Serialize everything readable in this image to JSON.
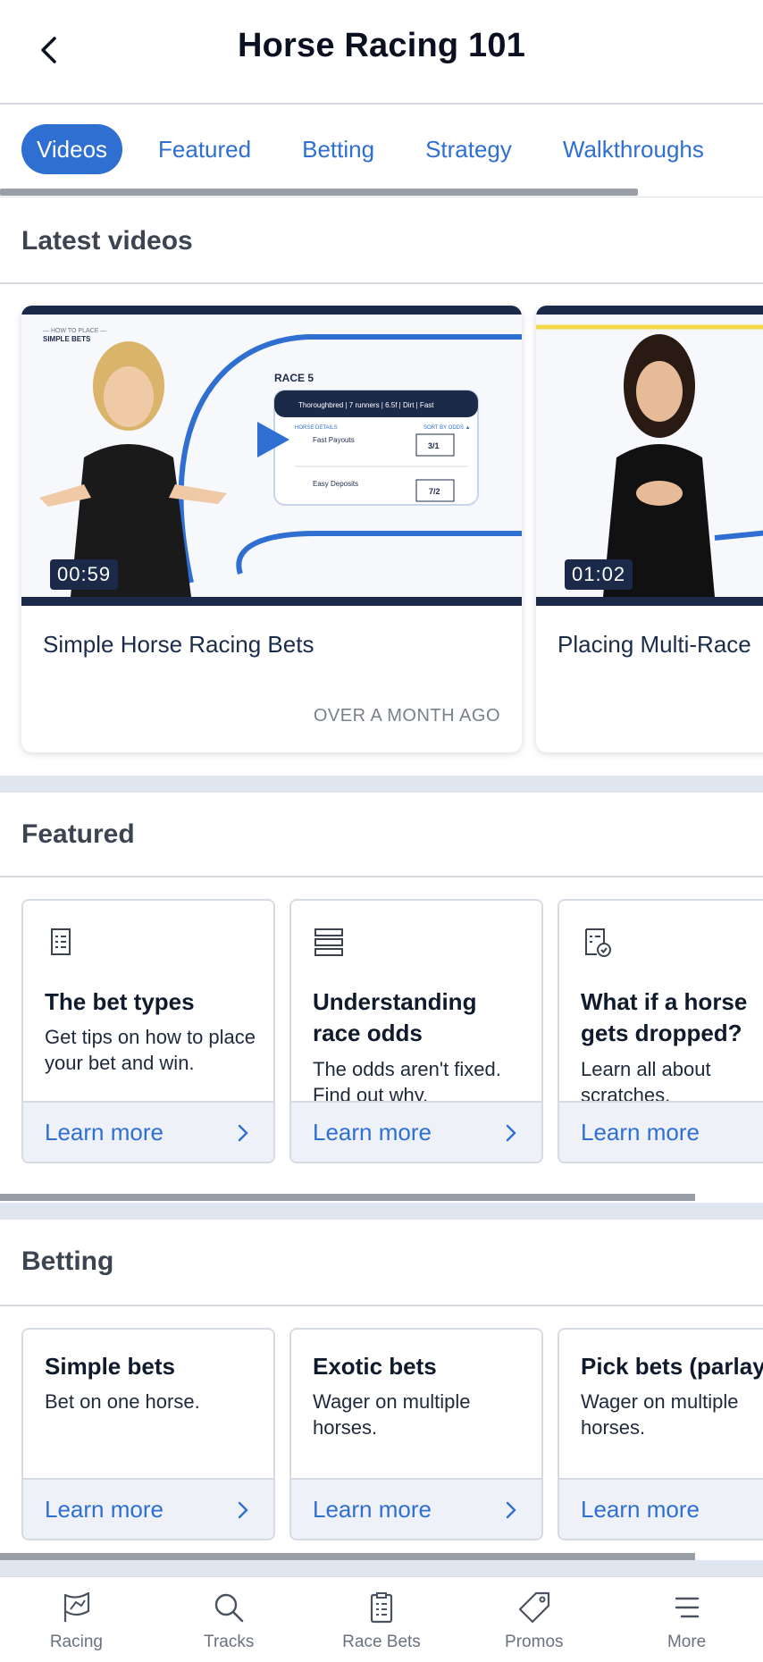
{
  "header": {
    "title": "Horse Racing 101"
  },
  "tabs": [
    {
      "label": "Videos",
      "active": true
    },
    {
      "label": "Featured",
      "active": false
    },
    {
      "label": "Betting",
      "active": false
    },
    {
      "label": "Strategy",
      "active": false
    },
    {
      "label": "Walkthroughs",
      "active": false
    }
  ],
  "latest_videos": {
    "title": "Latest videos",
    "videos": [
      {
        "title": "Simple Horse Racing Bets",
        "duration": "00:59",
        "posted": "OVER A MONTH AGO"
      },
      {
        "title": "Placing Multi-Race",
        "duration": "01:02",
        "posted": ""
      }
    ],
    "thumb_text": {
      "brand_line1": "— HOW TO PLACE —",
      "brand_line2": "SIMPLE BETS",
      "race": "RACE 5",
      "race_info": "Thoroughbred | 7 runners | 6.5f | Dirt | Fast",
      "horse_details": "HORSE DETAILS",
      "sort": "SORT BY ODDS ▲",
      "runner1": "Fast Payouts",
      "odds1": "3/1",
      "runner2": "Easy Deposits",
      "odds2": "7/2"
    }
  },
  "featured": {
    "title": "Featured",
    "cards": [
      {
        "icon": "checklist-icon",
        "title": "The bet types",
        "desc": "Get tips on how to place your bet and win.",
        "cta": "Learn more"
      },
      {
        "icon": "stack-icon",
        "title": "Understanding race odds",
        "desc": "The odds aren't fixed. Find out why.",
        "cta": "Learn more"
      },
      {
        "icon": "clipboard-clock-icon",
        "title": "What if a horse gets dropped?",
        "desc": "Learn all about scratches.",
        "cta": "Learn more"
      }
    ]
  },
  "betting": {
    "title": "Betting",
    "cards": [
      {
        "title": "Simple bets",
        "desc": "Bet on one horse.",
        "cta": "Learn more"
      },
      {
        "title": "Exotic bets",
        "desc": "Wager on multiple horses.",
        "cta": "Learn more"
      },
      {
        "title": "Pick bets (parlay",
        "desc": "Wager on multiple horses.",
        "cta": "Learn more"
      }
    ]
  },
  "bottom_nav": [
    {
      "label": "Racing",
      "icon": "racing-flag-icon"
    },
    {
      "label": "Tracks",
      "icon": "search-icon"
    },
    {
      "label": "Race Bets",
      "icon": "betslip-icon"
    },
    {
      "label": "Promos",
      "icon": "tag-icon"
    },
    {
      "label": "More",
      "icon": "menu-icon"
    }
  ],
  "colors": {
    "accent": "#2f6fd1",
    "navy": "#1c2a4a",
    "muted": "#6a7280",
    "divider": "#dfe6f0"
  }
}
